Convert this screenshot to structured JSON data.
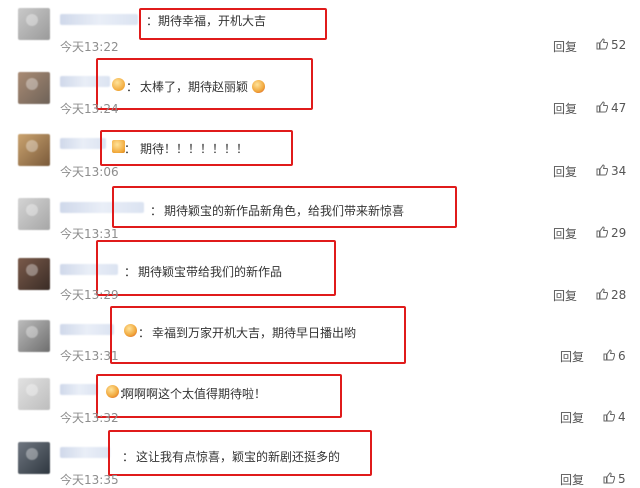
{
  "comments": [
    {
      "text": "期待幸福，开机大吉",
      "time": "今天13:22",
      "reply": "回复",
      "likes": "52"
    },
    {
      "text": "太棒了，期待赵丽颖",
      "time": "今天13:24",
      "reply": "回复",
      "likes": "47"
    },
    {
      "text": "期待！！！！！！！",
      "time": "今天13:06",
      "reply": "回复",
      "likes": "34"
    },
    {
      "text": "期待颖宝的新作品新角色，给我们带来新惊喜",
      "time": "今天13:31",
      "reply": "回复",
      "likes": "29"
    },
    {
      "text": "期待颖宝带给我们的新作品",
      "time": "今天13:29",
      "reply": "回复",
      "likes": "28"
    },
    {
      "text": "幸福到万家开机大吉，期待早日播出哟",
      "time": "今天13:31",
      "reply": "回复",
      "likes": "6"
    },
    {
      "text": "啊啊啊这个太值得期待啦！",
      "time": "今天13:32",
      "reply": "回复",
      "likes": "4"
    },
    {
      "text": "这让我有点惊喜，颖宝的新剧还挺多的",
      "time": "今天13:35",
      "reply": "回复",
      "likes": "5"
    }
  ],
  "colon": "：",
  "icons": {
    "like": "thumbs-up-icon",
    "emoji": "smiley-emoji-icon"
  },
  "colors": {
    "highlight": "#e01b1b",
    "time": "#8d8d8d",
    "username": "#cfd8ea"
  }
}
